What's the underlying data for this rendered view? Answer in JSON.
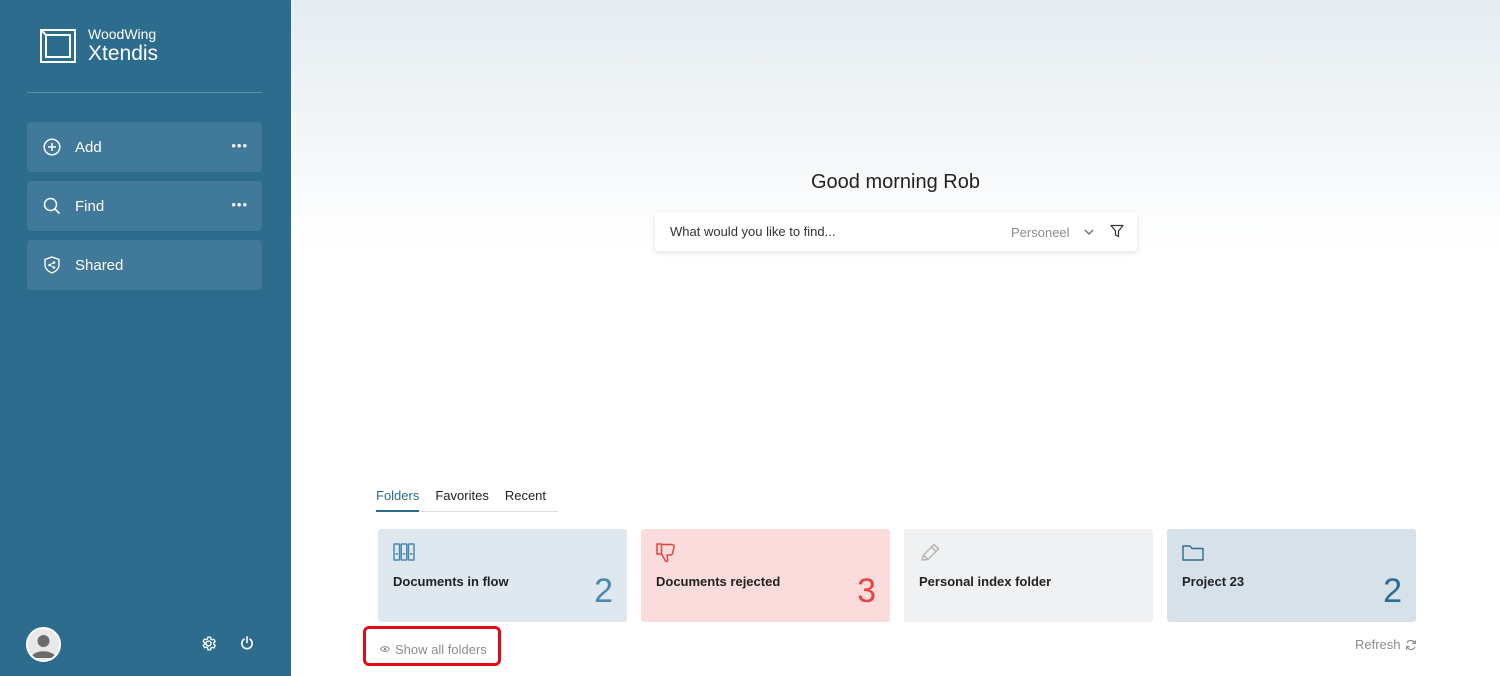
{
  "app": {
    "brand_small": "WoodWing",
    "brand_big": "Xtendis"
  },
  "sidebar": {
    "items": [
      {
        "label": "Add",
        "icon": "plus-circle-icon",
        "more": "•••"
      },
      {
        "label": "Find",
        "icon": "search-icon",
        "more": "•••"
      },
      {
        "label": "Shared",
        "icon": "shield-share-icon"
      }
    ],
    "footer_icons": [
      "avatar",
      "gear-icon",
      "power-icon"
    ]
  },
  "main": {
    "greeting": "Good morning Rob",
    "search": {
      "placeholder": "What would you like to find...",
      "scope": "Personeel"
    },
    "tabs": [
      {
        "label": "Folders",
        "active": true
      },
      {
        "label": "Favorites",
        "active": false
      },
      {
        "label": "Recent",
        "active": false
      }
    ],
    "cards": [
      {
        "label": "Documents in flow",
        "count": "2",
        "icon": "binders-icon",
        "bg": "#dfe8ef",
        "count_color": "#4a8ab0"
      },
      {
        "label": "Documents rejected",
        "count": "3",
        "icon": "thumbs-down-icon",
        "bg": "#f9dcdb",
        "count_color": "#e5443f"
      },
      {
        "label": "Personal index folder",
        "count": "",
        "icon": "pencil-icon",
        "bg": "#eff1f3",
        "count_color": "#4a8ab0"
      },
      {
        "label": "Project 23",
        "count": "2",
        "icon": "folder-icon",
        "bg": "#d6e1ea",
        "count_color": "#2e6c8e"
      }
    ],
    "show_all": "Show all folders",
    "refresh": "Refresh"
  },
  "colors": {
    "sidebar": "#2e6c8e",
    "nav_item": "#40799a",
    "accent": "#2e6c8e",
    "highlight": "#e00b16"
  }
}
